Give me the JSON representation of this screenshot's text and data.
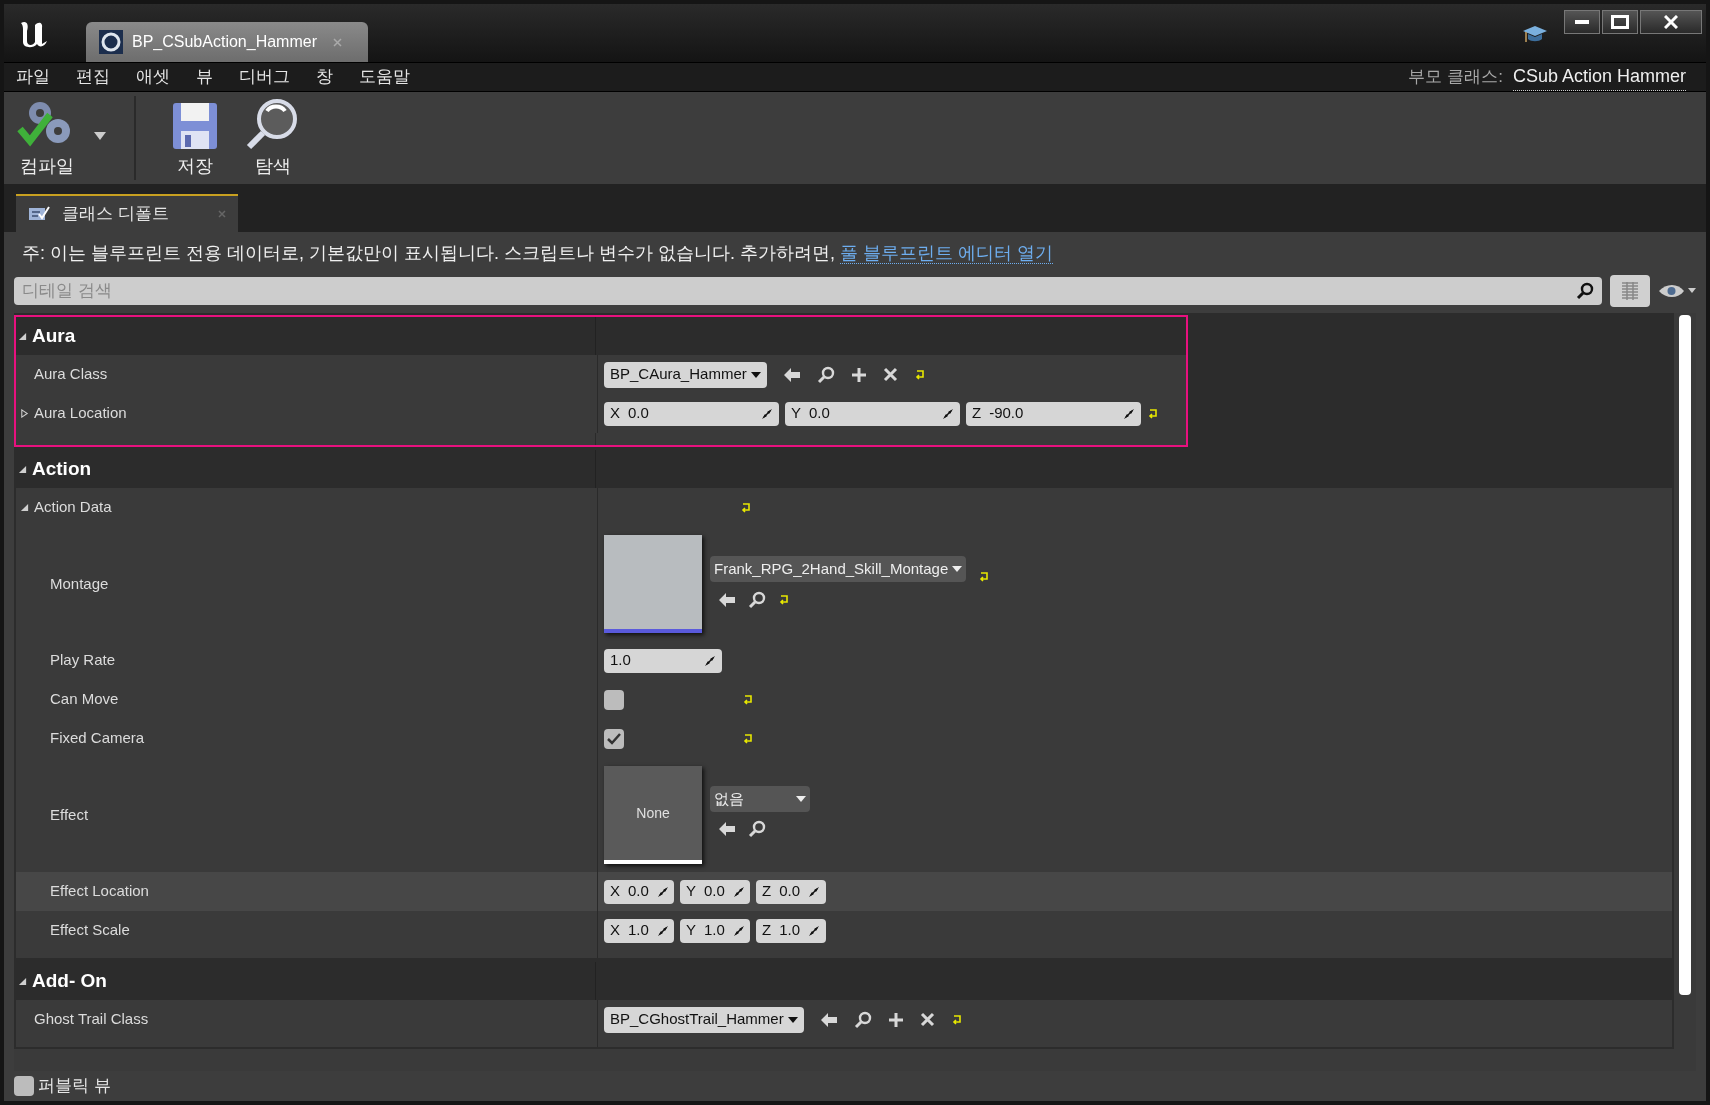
{
  "window": {
    "tab_title": "BP_CSubAction_Hammer"
  },
  "menu": [
    "파일",
    "편집",
    "애셋",
    "뷰",
    "디버그",
    "창",
    "도움말"
  ],
  "parent_class": {
    "label": "부모 클래스:",
    "value": "CSub Action Hammer"
  },
  "toolbar": [
    {
      "kind": "compile",
      "label": "컴파일"
    },
    {
      "kind": "save",
      "label": "저장"
    },
    {
      "kind": "browse",
      "label": "탐색"
    }
  ],
  "panel_tab": {
    "label": "클래스 디폴트"
  },
  "notice": {
    "text": "주: 이는 블루프린트 전용 데이터로, 기본값만이 표시됩니다. 스크립트나 변수가 없습니다. 추가하려면,",
    "link": "풀 블루프린트 에디터 열기"
  },
  "search": {
    "placeholder": "디테일 검색"
  },
  "categories": [
    {
      "title": "Aura",
      "expanded": true,
      "highlighted": true,
      "properties": [
        {
          "kind": "class_picker",
          "label": "Aura Class",
          "value": "BP_CAura_Hammer",
          "reset": true
        },
        {
          "kind": "vector",
          "label": "Aura Location",
          "expanded": false,
          "reset": true,
          "components": [
            {
              "axis": "X",
              "value": "0.0"
            },
            {
              "axis": "Y",
              "value": "0.0"
            },
            {
              "axis": "Z",
              "value": "-90.0"
            }
          ]
        }
      ]
    },
    {
      "title": "Action",
      "expanded": true,
      "highlighted": false,
      "properties": [
        {
          "kind": "struct",
          "label": "Action Data",
          "expanded": true,
          "reset": true,
          "children": [
            {
              "kind": "asset",
              "label": "Montage",
              "value": "Frank_RPG_2Hand_Skill_Montage",
              "reset": true,
              "hovered": false
            },
            {
              "kind": "number",
              "label": "Play Rate",
              "value": "1.0",
              "reset": false,
              "hovered": false
            },
            {
              "kind": "checkbox",
              "label": "Can Move",
              "checked": false,
              "reset": true,
              "hovered": false
            },
            {
              "kind": "checkbox",
              "label": "Fixed Camera",
              "checked": true,
              "reset": true,
              "hovered": false
            },
            {
              "kind": "asset",
              "label": "Effect",
              "thumbnail_text": "None",
              "value": "없음",
              "reset": false,
              "hovered": false
            },
            {
              "kind": "vector",
              "label": "Effect Location",
              "reset": false,
              "hovered": true,
              "components": [
                {
                  "axis": "X",
                  "value": "0.0"
                },
                {
                  "axis": "Y",
                  "value": "0.0"
                },
                {
                  "axis": "Z",
                  "value": "0.0"
                }
              ]
            },
            {
              "kind": "vector",
              "label": "Effect Scale",
              "reset": false,
              "hovered": false,
              "components": [
                {
                  "axis": "X",
                  "value": "1.0"
                },
                {
                  "axis": "Y",
                  "value": "1.0"
                },
                {
                  "axis": "Z",
                  "value": "1.0"
                }
              ]
            }
          ]
        }
      ]
    },
    {
      "title": "Add- On",
      "expanded": true,
      "highlighted": false,
      "properties": [
        {
          "kind": "class_picker",
          "label": "Ghost Trail Class",
          "value": "BP_CGhostTrail_Hammer",
          "reset": true
        }
      ]
    }
  ],
  "public_view": {
    "label": "퍼블릭 뷰",
    "checked": false
  }
}
